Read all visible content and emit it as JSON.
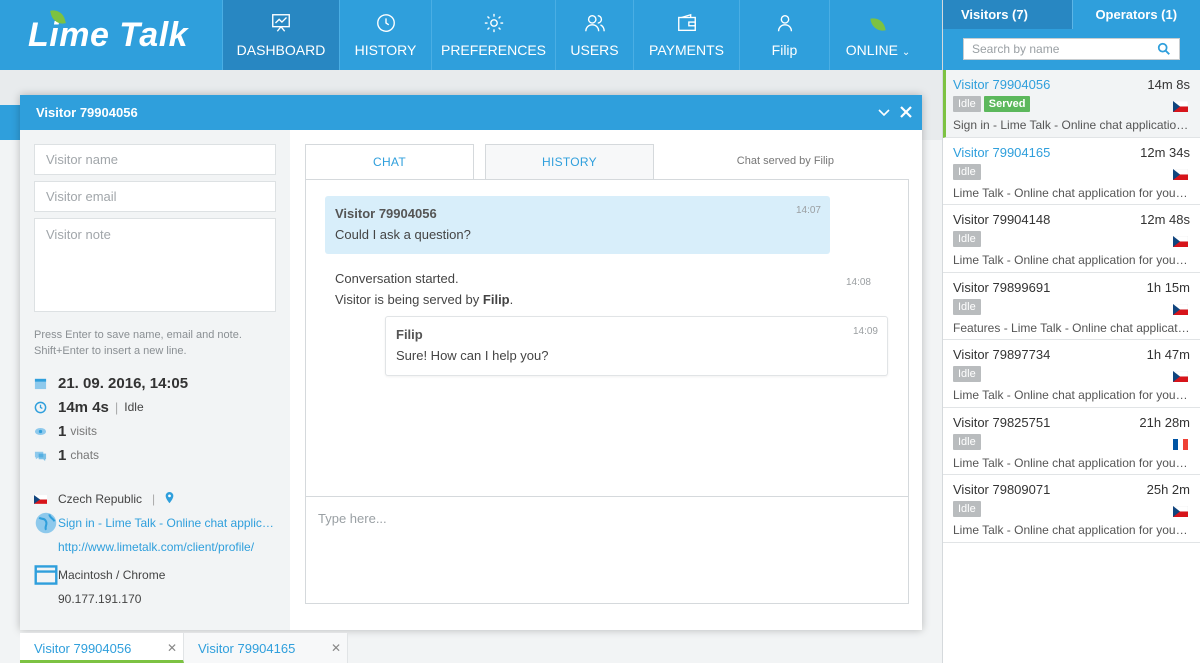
{
  "app": {
    "logo": "Lime Talk"
  },
  "nav": [
    {
      "label": "DASHBOARD",
      "icon": "dashboard-icon"
    },
    {
      "label": "HISTORY",
      "icon": "history-icon"
    },
    {
      "label": "PREFERENCES",
      "icon": "gear-icon"
    },
    {
      "label": "USERS",
      "icon": "users-icon"
    },
    {
      "label": "PAYMENTS",
      "icon": "wallet-icon"
    },
    {
      "label": "Filip",
      "icon": "user-icon"
    },
    {
      "label": "ONLINE",
      "icon": "leaf-icon"
    }
  ],
  "sidebar": {
    "tab_visitors": "Visitors (7)",
    "tab_operators": "Operators (1)",
    "search_placeholder": "Search by name",
    "visitors": [
      {
        "name": "Visitor 79904056",
        "time": "14m 8s",
        "badges": [
          "Idle",
          "Served"
        ],
        "page": "Sign in - Lime Talk - Online chat application for your website",
        "flag": "cz"
      },
      {
        "name": "Visitor 79904165",
        "time": "12m 34s",
        "badges": [
          "Idle"
        ],
        "page": "Lime Talk - Online chat application for your website",
        "flag": "cz"
      },
      {
        "name": "Visitor 79904148",
        "time": "12m 48s",
        "badges": [
          "Idle"
        ],
        "page": "Lime Talk - Online chat application for your website",
        "flag": "cz"
      },
      {
        "name": "Visitor 79899691",
        "time": "1h 15m",
        "badges": [
          "Idle"
        ],
        "page": "Features - Lime Talk - Online chat application for your website",
        "flag": "cz"
      },
      {
        "name": "Visitor 79897734",
        "time": "1h 47m",
        "badges": [
          "Idle"
        ],
        "page": "Lime Talk - Online chat application for your website",
        "flag": "cz"
      },
      {
        "name": "Visitor 79825751",
        "time": "21h 28m",
        "badges": [
          "Idle"
        ],
        "page": "Lime Talk - Online chat application for your website",
        "flag": "fr"
      },
      {
        "name": "Visitor 79809071",
        "time": "25h 2m",
        "badges": [
          "Idle"
        ],
        "page": "Lime Talk - Online chat application for your website",
        "flag": "cz"
      }
    ]
  },
  "chat_window": {
    "title": "Visitor 79904056",
    "name_placeholder": "Visitor name",
    "email_placeholder": "Visitor email",
    "note_placeholder": "Visitor note",
    "hint_line1": "Press Enter to save name, email and note.",
    "hint_line2": "Shift+Enter to insert a new line.",
    "date": "21. 09. 2016, 14:05",
    "duration": "14m 4s",
    "status": "Idle",
    "visits_count": "1",
    "visits_label": "visits",
    "chats_count": "1",
    "chats_label": "chats",
    "country": "Czech Republic",
    "page_title": "Sign in - Lime Talk - Online chat application for your website",
    "page_url": "http://www.limetalk.com/client/profile/",
    "platform": "Macintosh / Chrome",
    "ip": "90.177.191.170",
    "tab_chat": "CHAT",
    "tab_history": "HISTORY",
    "served_by_prefix": "Chat served by",
    "served_by": "Filip",
    "messages": {
      "visitor_name": "Visitor 79904056",
      "visitor_text": "Could I ask a question?",
      "visitor_time": "14:07",
      "sys_line1": "Conversation started.",
      "sys_line2_prefix": "Visitor is being served by",
      "sys_line2_name": "Filip",
      "sys_line2_suffix": ".",
      "sys_time": "14:08",
      "op_name": "Filip",
      "op_text": "Sure! How can I help you?",
      "op_time": "14:09"
    },
    "compose_placeholder": "Type here..."
  },
  "bottom_tabs": [
    {
      "label": "Visitor 79904056"
    },
    {
      "label": "Visitor 79904165"
    }
  ],
  "colors": {
    "primary": "#2f9fdc",
    "primary_dark": "#2887c2",
    "accent": "#7cc242",
    "served": "#5cb85c",
    "idle": "#b9bcbe",
    "visitor_bubble": "#d8eefa"
  }
}
